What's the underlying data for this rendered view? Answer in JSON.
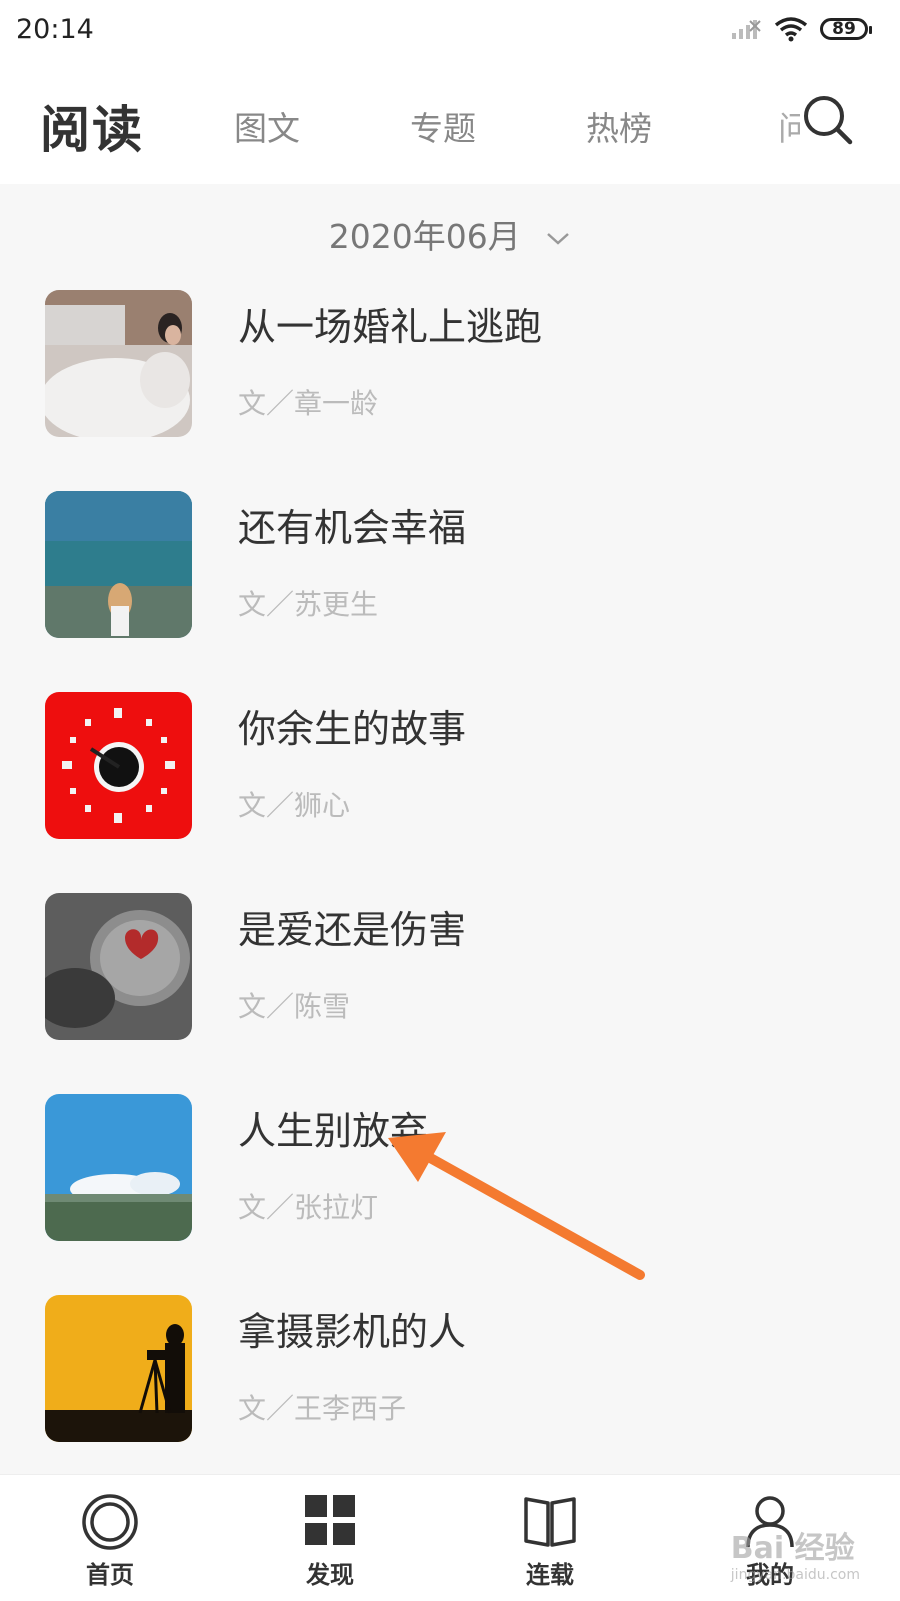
{
  "status_bar": {
    "time": "20:14",
    "battery": "89"
  },
  "header": {
    "title": "阅读",
    "tabs": [
      {
        "label": "图文"
      },
      {
        "label": "专题"
      },
      {
        "label": "热榜"
      },
      {
        "label": "问答"
      }
    ]
  },
  "month_selector": {
    "label": "2020年06月"
  },
  "articles": [
    {
      "title": "从一场婚礼上逃跑",
      "author": "文／章一龄"
    },
    {
      "title": "还有机会幸福",
      "author": "文／苏更生"
    },
    {
      "title": "你余生的故事",
      "author": "文／狮心"
    },
    {
      "title": "是爱还是伤害",
      "author": "文／陈雪"
    },
    {
      "title": "人生别放弃",
      "author": "文／张拉灯"
    },
    {
      "title": "拿摄影机的人",
      "author": "文／王李西子"
    }
  ],
  "bottom_nav": {
    "items": [
      {
        "label": "首页",
        "icon": "home-circle-icon"
      },
      {
        "label": "发现",
        "icon": "grid-icon"
      },
      {
        "label": "连载",
        "icon": "book-icon"
      },
      {
        "label": "我的",
        "icon": "person-icon"
      }
    ]
  },
  "watermark": {
    "brand": "Bai 经验",
    "url": "jingyan.baidu.com"
  },
  "colors": {
    "annotation_arrow": "#f47a30",
    "background": "#f7f7f7",
    "header": "#ffffff"
  }
}
